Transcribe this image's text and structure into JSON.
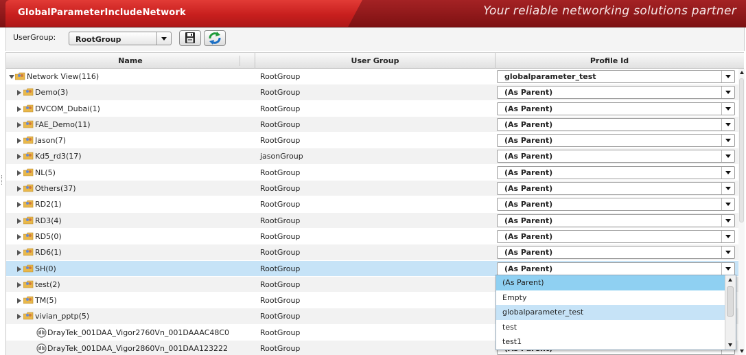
{
  "header": {
    "title": "GlobalParameterIncludeNetwork",
    "slogan": "Your reliable networking solutions partner"
  },
  "toolbar": {
    "usergroup_label": "UserGroup:",
    "usergroup_value": "RootGroup",
    "save_icon": "save-icon",
    "refresh_icon": "refresh-icon"
  },
  "columns": {
    "name": "Name",
    "group": "User Group",
    "profile": "Profile Id"
  },
  "rows": [
    {
      "name": "Network View(116)",
      "group": "RootGroup",
      "profile": "globalparameter_test",
      "type": "folder",
      "expanded": true,
      "level": 0
    },
    {
      "name": "Demo(3)",
      "group": "RootGroup",
      "profile": "(As Parent)",
      "type": "folder",
      "level": 1
    },
    {
      "name": "DVCOM_Dubai(1)",
      "group": "RootGroup",
      "profile": "(As Parent)",
      "type": "folder",
      "level": 1
    },
    {
      "name": "FAE_Demo(11)",
      "group": "RootGroup",
      "profile": "(As Parent)",
      "type": "folder",
      "level": 1
    },
    {
      "name": "Jason(7)",
      "group": "RootGroup",
      "profile": "(As Parent)",
      "type": "folder",
      "level": 1
    },
    {
      "name": "Kd5_rd3(17)",
      "group": "jasonGroup",
      "profile": "(As Parent)",
      "type": "folder",
      "level": 1
    },
    {
      "name": "NL(5)",
      "group": "RootGroup",
      "profile": "(As Parent)",
      "type": "folder",
      "level": 1
    },
    {
      "name": "Others(37)",
      "group": "RootGroup",
      "profile": "(As Parent)",
      "type": "folder",
      "level": 1
    },
    {
      "name": "RD2(1)",
      "group": "RootGroup",
      "profile": "(As Parent)",
      "type": "folder",
      "level": 1
    },
    {
      "name": "RD3(4)",
      "group": "RootGroup",
      "profile": "(As Parent)",
      "type": "folder",
      "level": 1
    },
    {
      "name": "RD5(0)",
      "group": "RootGroup",
      "profile": "(As Parent)",
      "type": "folder",
      "level": 1
    },
    {
      "name": "RD6(1)",
      "group": "RootGroup",
      "profile": "(As Parent)",
      "type": "folder",
      "level": 1
    },
    {
      "name": "SH(0)",
      "group": "RootGroup",
      "profile": "(As Parent)",
      "type": "folder",
      "level": 1,
      "selected": true
    },
    {
      "name": "test(2)",
      "group": "RootGroup",
      "profile": "",
      "type": "folder",
      "level": 1
    },
    {
      "name": "TM(5)",
      "group": "RootGroup",
      "profile": "",
      "type": "folder",
      "level": 1
    },
    {
      "name": "vivian_pptp(5)",
      "group": "RootGroup",
      "profile": "",
      "type": "folder",
      "level": 1
    },
    {
      "name": "DrayTek_001DAA_Vigor2760Vn_001DAAAC48C0",
      "group": "RootGroup",
      "profile": "",
      "type": "device",
      "level": 1
    },
    {
      "name": "DrayTek_001DAA_Vigor2860Vn_001DAA123222",
      "group": "RootGroup",
      "profile": "(As Parent)",
      "type": "device",
      "level": 1
    }
  ],
  "dropdown": {
    "options": [
      "(As Parent)",
      "Empty",
      "globalparameter_test",
      "test",
      "test1"
    ],
    "highlighted": "globalparameter_test"
  },
  "colors": {
    "title_red": "#c81f1e",
    "selected_row": "#c6e3f7",
    "dropdown_first": "#8fd0f2"
  }
}
